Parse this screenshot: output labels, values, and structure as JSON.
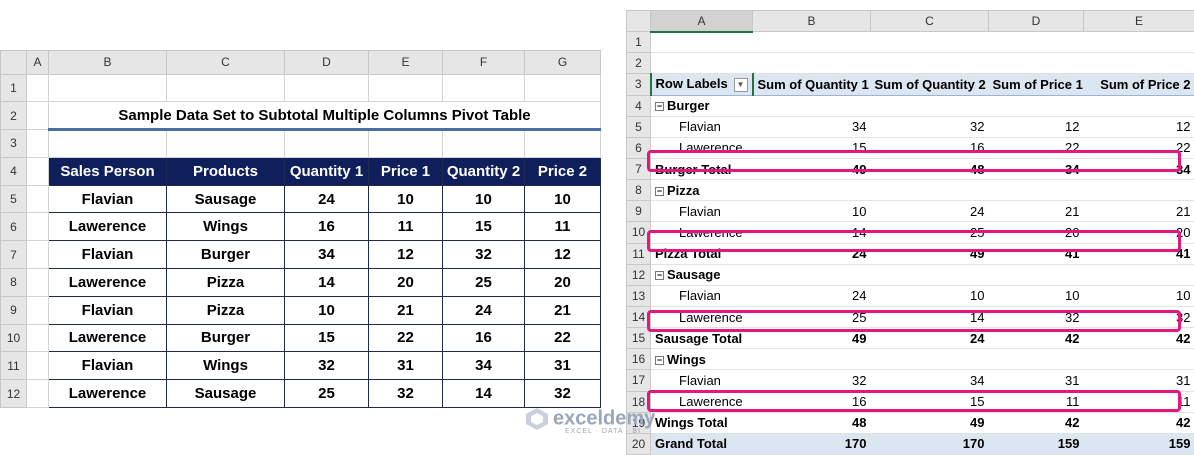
{
  "left": {
    "columns": [
      "A",
      "B",
      "C",
      "D",
      "E",
      "F",
      "G"
    ],
    "rows": [
      "1",
      "2",
      "3",
      "4",
      "5",
      "6",
      "7",
      "8",
      "9",
      "10",
      "11",
      "12"
    ],
    "title": "Sample Data Set to Subtotal Multiple Columns Pivot Table",
    "headers": [
      "Sales Person",
      "Products",
      "Quantity 1",
      "Price 1",
      "Quantity 2",
      "Price 2"
    ],
    "data": [
      [
        "Flavian",
        "Sausage",
        "24",
        "10",
        "10",
        "10"
      ],
      [
        "Lawerence",
        "Wings",
        "16",
        "11",
        "15",
        "11"
      ],
      [
        "Flavian",
        "Burger",
        "34",
        "12",
        "32",
        "12"
      ],
      [
        "Lawerence",
        "Pizza",
        "14",
        "20",
        "25",
        "20"
      ],
      [
        "Flavian",
        "Pizza",
        "10",
        "21",
        "24",
        "21"
      ],
      [
        "Lawerence",
        "Burger",
        "15",
        "22",
        "16",
        "22"
      ],
      [
        "Flavian",
        "Wings",
        "32",
        "31",
        "34",
        "31"
      ],
      [
        "Lawerence",
        "Sausage",
        "25",
        "32",
        "14",
        "32"
      ]
    ]
  },
  "pivot": {
    "columns": [
      "A",
      "B",
      "C",
      "D",
      "E"
    ],
    "header_row": [
      "Row Labels",
      "Sum of Quantity 1",
      "Sum of Quantity 2",
      "Sum of Price 1",
      "Sum of Price 2"
    ],
    "rows": [
      {
        "n": "4",
        "type": "group",
        "label": "Burger",
        "vals": [
          "",
          "",
          "",
          ""
        ]
      },
      {
        "n": "5",
        "type": "item",
        "label": "Flavian",
        "vals": [
          "34",
          "32",
          "12",
          "12"
        ]
      },
      {
        "n": "6",
        "type": "item",
        "label": "Lawerence",
        "vals": [
          "15",
          "16",
          "22",
          "22"
        ]
      },
      {
        "n": "7",
        "type": "total",
        "label": "Burger Total",
        "vals": [
          "49",
          "48",
          "34",
          "34"
        ]
      },
      {
        "n": "8",
        "type": "group",
        "label": "Pizza",
        "vals": [
          "",
          "",
          "",
          ""
        ]
      },
      {
        "n": "9",
        "type": "item",
        "label": "Flavian",
        "vals": [
          "10",
          "24",
          "21",
          "21"
        ]
      },
      {
        "n": "10",
        "type": "item",
        "label": "Lawerence",
        "vals": [
          "14",
          "25",
          "20",
          "20"
        ]
      },
      {
        "n": "11",
        "type": "total",
        "label": "Pizza Total",
        "vals": [
          "24",
          "49",
          "41",
          "41"
        ]
      },
      {
        "n": "12",
        "type": "group",
        "label": "Sausage",
        "vals": [
          "",
          "",
          "",
          ""
        ]
      },
      {
        "n": "13",
        "type": "item",
        "label": "Flavian",
        "vals": [
          "24",
          "10",
          "10",
          "10"
        ]
      },
      {
        "n": "14",
        "type": "item",
        "label": "Lawerence",
        "vals": [
          "25",
          "14",
          "32",
          "32"
        ]
      },
      {
        "n": "15",
        "type": "total",
        "label": "Sausage Total",
        "vals": [
          "49",
          "24",
          "42",
          "42"
        ]
      },
      {
        "n": "16",
        "type": "group",
        "label": "Wings",
        "vals": [
          "",
          "",
          "",
          ""
        ]
      },
      {
        "n": "17",
        "type": "item",
        "label": "Flavian",
        "vals": [
          "32",
          "34",
          "31",
          "31"
        ]
      },
      {
        "n": "18",
        "type": "item",
        "label": "Lawerence",
        "vals": [
          "16",
          "15",
          "11",
          "11"
        ]
      },
      {
        "n": "19",
        "type": "total",
        "label": "Wings Total",
        "vals": [
          "48",
          "49",
          "42",
          "42"
        ]
      },
      {
        "n": "20",
        "type": "grand",
        "label": "Grand Total",
        "vals": [
          "170",
          "170",
          "159",
          "159"
        ]
      }
    ]
  },
  "watermark": {
    "brand": "exceldemy",
    "tagline": "EXCEL · DATA · BI"
  },
  "colors": {
    "header_bg": "#0f1f5c",
    "highlight": "#e0187f",
    "pivot_header": "#dce6f1"
  }
}
